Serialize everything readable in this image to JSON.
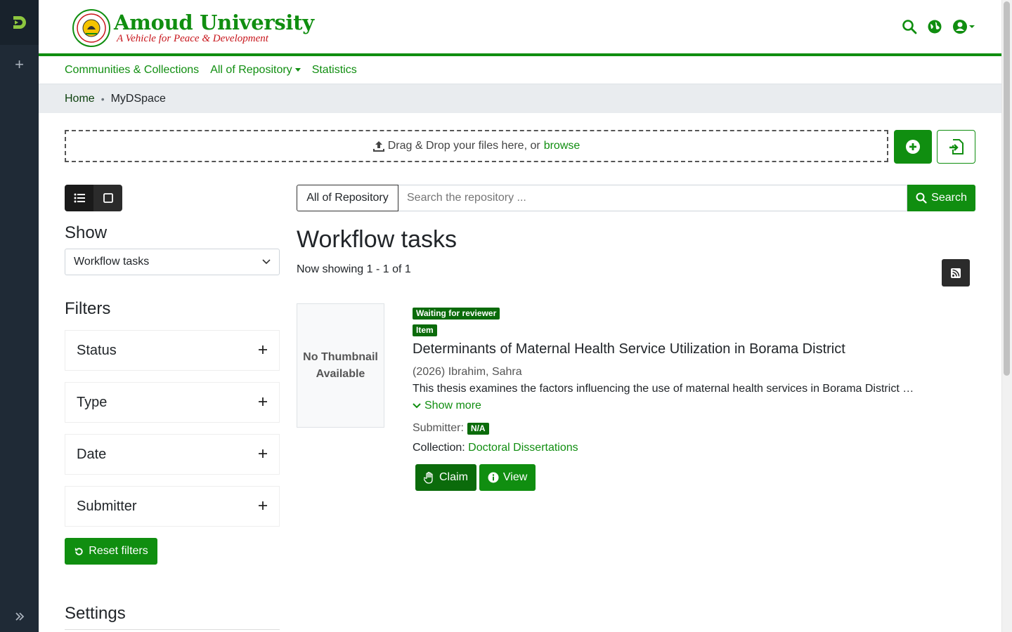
{
  "header": {
    "logo_title": "Amoud University",
    "logo_subtitle": "A Vehicle for Peace & Development",
    "brand_color": "#108e10"
  },
  "nav": {
    "items": [
      {
        "label": "Communities & Collections"
      },
      {
        "label": "All of Repository",
        "dropdown": true
      },
      {
        "label": "Statistics"
      }
    ]
  },
  "breadcrumb": {
    "home": "Home",
    "current": "MyDSpace"
  },
  "upload": {
    "text": "Drag & Drop your files here, or",
    "link": "browse"
  },
  "sidebar": {
    "show_heading": "Show",
    "show_value": "Workflow tasks",
    "filters_heading": "Filters",
    "facets": [
      "Status",
      "Type",
      "Date",
      "Submitter"
    ],
    "reset_label": "Reset filters",
    "settings_heading": "Settings"
  },
  "search": {
    "scope": "All of Repository",
    "placeholder": "Search the repository ...",
    "button": "Search"
  },
  "results": {
    "heading": "Workflow tasks",
    "showing": "Now showing 1 - 1 of 1"
  },
  "item": {
    "thumbnail_text": "No Thumbnail Available",
    "status_badge": "Waiting for reviewer",
    "type_badge": "Item",
    "title": "Determinants of Maternal Health Service Utilization in Borama District",
    "meta": "(2026) Ibrahim, Sahra",
    "abstract": "This thesis examines the factors influencing the use of maternal health services in Borama District and proposes recommendations for improvement.",
    "show_more": "Show more",
    "submitter_label": "Submitter:",
    "submitter_value": "N/A",
    "collection_label": "Collection:",
    "collection_value": "Doctoral Dissertations",
    "claim_label": "Claim",
    "view_label": "View"
  }
}
